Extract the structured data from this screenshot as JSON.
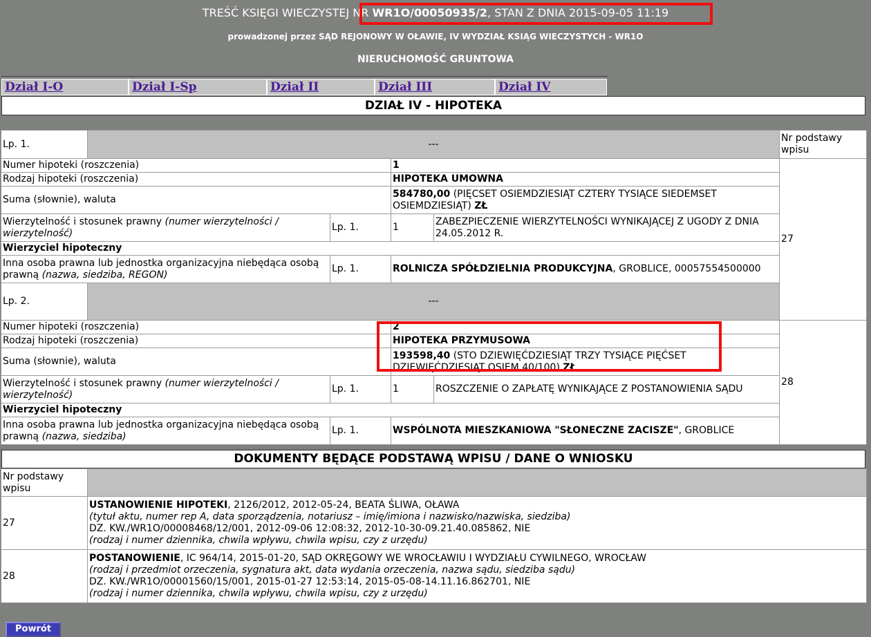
{
  "header": {
    "title_prefix": "TREŚĆ KSIĘGI WIECZYSTEJ NR ",
    "kw_number": "WR1O/00050935/2",
    "title_suffix": ", STAN Z DNIA 2015-09-05 11:19",
    "court": "prowadzonej przez SĄD REJONOWY W OŁAWIE, IV WYDZIAŁ KSIĄG WIECZYSTYCH - WR1O",
    "property_type": "NIERUCHOMOŚĆ GRUNTOWA"
  },
  "tabs": [
    {
      "label": "Dział I-O"
    },
    {
      "label": "Dział I-Sp"
    },
    {
      "label": "Dział II"
    },
    {
      "label": "Dział III"
    },
    {
      "label": "Dział IV"
    }
  ],
  "section_title": "DZIAŁ IV - HIPOTEKA",
  "labels": {
    "nr_podstawy": "Nr podstawy wpisu",
    "dashes": "---",
    "numer_hipoteki": "Numer hipoteki (roszczenia)",
    "rodzaj_hipoteki": "Rodzaj hipoteki (roszczenia)",
    "suma": "Suma (słownie), waluta",
    "wierzytelnosc": "Wierzytelność i stosunek prawny ",
    "wierzytelnosc_italic": "(numer wierzytelności / wierzytelność)",
    "wierzyciel": "Wierzyciel hipoteczny",
    "inna_osoba": "Inna osoba prawna lub jednostka organizacyjna niebędąca osobą prawną ",
    "inna_osoba_italic_1": "(nazwa, siedziba, REGON)",
    "inna_osoba_italic_2": "(nazwa, siedziba)"
  },
  "entries": [
    {
      "lp": "Lp. 1.",
      "nr_podstawy": "27",
      "numer": "1",
      "rodzaj": "HIPOTEKA UMOWNA",
      "suma_amount": "584780,00",
      "suma_words": " (PIĘCSET OSIEMDZIESIĄT CZTERY TYSIĄCE SIEDEMSET OSIEMDZIESIĄT) ",
      "suma_currency": "ZŁ",
      "wierz_lp": "Lp. 1.",
      "wierz_nr": "1",
      "wierz_text": "ZABEZPIECZENIE WIERZYTELNOŚCI WYNIKAJĄCEJ Z UGODY Z DNIA 24.05.2012 R.",
      "osoba_lp": "Lp. 1.",
      "osoba_name": "ROLNICZA SPÓŁDZIELNIA PRODUKCYJNA",
      "osoba_rest": ", GROBLICE, 00057554500000"
    },
    {
      "lp": "Lp. 2.",
      "nr_podstawy": "28",
      "numer": "2",
      "rodzaj": "HIPOTEKA PRZYMUSOWA",
      "suma_amount": "193598,40",
      "suma_words": " (STO DZIEWIĘĆDZIESIĄT TRZY TYSIĄCE PIĘĆSET DZIEWIĘĆDZIESIĄT OSIEM 40/100) ",
      "suma_currency": "ZŁ",
      "wierz_lp": "Lp. 1.",
      "wierz_nr": "1",
      "wierz_text": "ROSZCZENIE O ZAPŁATĘ WYNIKAJĄCE Z POSTANOWIENIA SĄDU",
      "osoba_lp": "Lp. 1.",
      "osoba_name": "WSPÓLNOTA MIESZKANIOWA \"SŁONECZNE ZACISZE\"",
      "osoba_rest": ", GROBLICE"
    }
  ],
  "documents_title": "DOKUMENTY BĘDĄCE PODSTAWĄ WPISU / DANE O WNIOSKU",
  "documents": [
    {
      "nr": "27",
      "title_bold": "USTANOWIENIE HIPOTEKI",
      "title_rest": ", 2126/2012, 2012-05-24, BEATA ŚLIWA, OŁAWA",
      "desc1": "(tytuł aktu, numer rep A, data sporządzenia, notariusz – imię/imiona i nazwisko/nazwiska, siedziba)",
      "dz": "DZ. KW./WR1O/00008468/12/001, 2012-09-06 12:08:32, 2012-10-30-09.21.40.085862, NIE",
      "desc2": "(rodzaj i numer dziennika, chwila wpływu, chwila wpisu, czy z urzędu)"
    },
    {
      "nr": "28",
      "title_bold": "POSTANOWIENIE",
      "title_rest": ", IC 964/14, 2015-01-20, SĄD OKRĘGOWY WE WROCŁAWIU I WYDZIAŁU CYWILNEGO, WROCŁAW",
      "desc1": "(rodzaj i przedmiot orzeczenia, sygnatura akt, data wydania orzeczenia, nazwa sądu, siedziba sądu)",
      "dz": "DZ. KW./WR1O/00001560/15/001, 2015-01-27 12:53:14, 2015-05-08-14.11.16.862701, NIE",
      "desc2": "(rodzaj i numer dziennika, chwila wpływu, chwila wpisu, czy z urzędu)"
    }
  ],
  "back_button": "Powrót"
}
